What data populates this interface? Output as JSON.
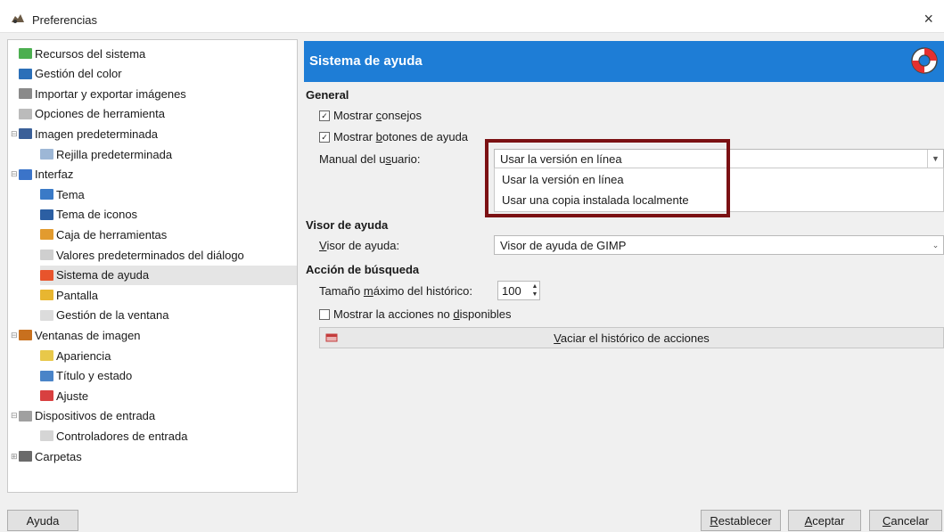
{
  "window": {
    "title": "Preferencias",
    "close_symbol": "×"
  },
  "tree": [
    {
      "label": "Recursos del sistema",
      "icon": "system-resources-icon",
      "color": "#4caf50"
    },
    {
      "label": "Gestión del color",
      "icon": "color-management-icon",
      "color": "#2b6fb8"
    },
    {
      "label": "Importar y exportar imágenes",
      "icon": "import-export-icon",
      "color": "#8a8a8a"
    },
    {
      "label": "Opciones de herramienta",
      "icon": "tool-options-icon",
      "color": "#bbbbbb"
    },
    {
      "label": "Imagen predeterminada",
      "icon": "default-image-icon",
      "color": "#3a5f98",
      "expander": "⊟"
    },
    {
      "label": "Rejilla predeterminada",
      "icon": "default-grid-icon",
      "color": "#9db7d6"
    },
    {
      "label": "Interfaz",
      "icon": "interface-icon",
      "color": "#3b74c9",
      "expander": "⊟"
    },
    {
      "label": "Tema",
      "icon": "theme-icon",
      "color": "#3a7ac7"
    },
    {
      "label": "Tema de iconos",
      "icon": "icon-theme-icon",
      "color": "#2c5fa3"
    },
    {
      "label": "Caja de herramientas",
      "icon": "toolbox-icon",
      "color": "#e29b2f"
    },
    {
      "label": "Valores predeterminados del diálogo",
      "icon": "dialog-defaults-icon",
      "color": "#cfcfcf"
    },
    {
      "label": "Sistema de ayuda",
      "icon": "help-system-icon",
      "color": "#e8542c",
      "selected": true
    },
    {
      "label": "Pantalla",
      "icon": "display-icon",
      "color": "#e8b630"
    },
    {
      "label": "Gestión de la ventana",
      "icon": "window-management-icon",
      "color": "#dcdcdc"
    },
    {
      "label": "Ventanas de imagen",
      "icon": "image-windows-icon",
      "color": "#c8701e",
      "expander": "⊟"
    },
    {
      "label": "Apariencia",
      "icon": "appearance-icon",
      "color": "#e8c84a"
    },
    {
      "label": "Título y estado",
      "icon": "title-status-icon",
      "color": "#4a84c8"
    },
    {
      "label": "Ajuste",
      "icon": "snapping-icon",
      "color": "#d84040"
    },
    {
      "label": "Dispositivos de entrada",
      "icon": "input-devices-icon",
      "color": "#a0a0a0",
      "expander": "⊟"
    },
    {
      "label": "Controladores de entrada",
      "icon": "input-controllers-icon",
      "color": "#d5d5d5"
    },
    {
      "label": "Carpetas",
      "icon": "folders-icon",
      "color": "#6a6a6a",
      "expander": "⊞"
    }
  ],
  "panel": {
    "title": "Sistema de ayuda",
    "header_icon": "lifebuoy-icon",
    "general": {
      "heading": "General",
      "show_tips": {
        "pre": "Mostrar ",
        "mn": "c",
        "post": "onsejos",
        "checked": true
      },
      "show_help_buttons": {
        "pre": "Mostrar ",
        "mn": "b",
        "post": "otones de ayuda",
        "checked": true
      },
      "manual": {
        "pre": "Manual del u",
        "mn": "s",
        "post": "uario:",
        "value": "Usar la versión en línea",
        "options": [
          "Usar la versión en línea",
          "Usar una copia instalada localmente"
        ]
      }
    },
    "viewer": {
      "heading": "Visor de ayuda",
      "label": {
        "mn": "V",
        "post": "isor de ayuda:"
      },
      "value": "Visor de ayuda de GIMP"
    },
    "search": {
      "heading": "Acción de búsqueda",
      "history": {
        "pre": "Tamaño ",
        "mn": "m",
        "post": "áximo del histórico:",
        "value": "100"
      },
      "show_unavailable": {
        "pre": "Mostrar la acciones no ",
        "mn": "d",
        "post": "isponibles",
        "checked": false
      },
      "clear_button": {
        "mn": "V",
        "post": "aciar el histórico de acciones"
      }
    }
  },
  "buttons": {
    "help": "Ayuda",
    "reset": {
      "mn": "R",
      "post": "establecer"
    },
    "ok": {
      "mn": "A",
      "post": "ceptar"
    },
    "cancel": {
      "mn": "C",
      "post": "ancelar"
    }
  }
}
